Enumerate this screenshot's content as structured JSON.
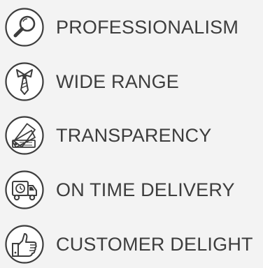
{
  "features": [
    {
      "label": "PROFESSIONALISM",
      "icon": "magnifier-icon"
    },
    {
      "label": "WIDE RANGE",
      "icon": "tie-icon"
    },
    {
      "label": "TRANSPARENCY",
      "icon": "swatch-tags-icon"
    },
    {
      "label": "ON TIME DELIVERY",
      "icon": "delivery-truck-icon"
    },
    {
      "label": "CUSTOMER DELIGHT",
      "icon": "thumbs-up-icon"
    }
  ],
  "colors": {
    "background": "#f3f3f3",
    "text": "#3d3d3d",
    "icon_stroke": "#3d3d3d"
  }
}
